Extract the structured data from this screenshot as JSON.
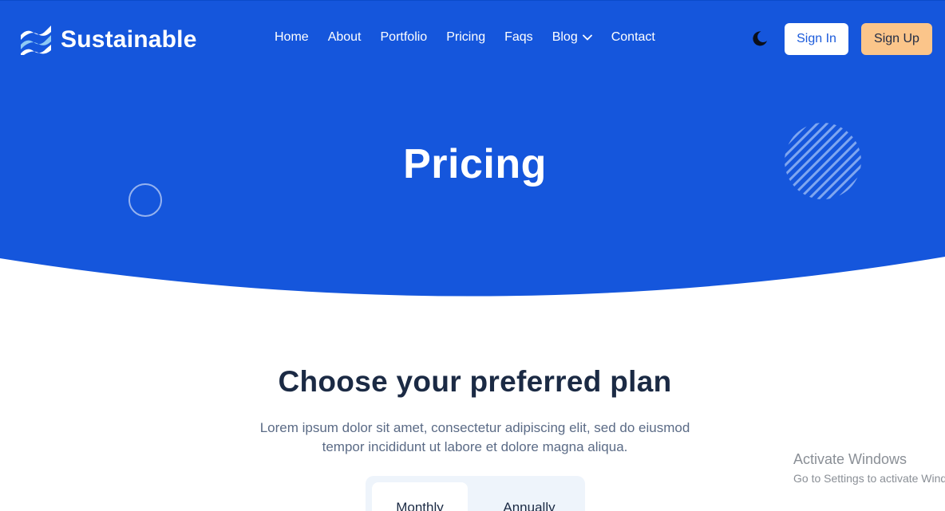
{
  "brand": {
    "name": "Sustainable",
    "primary_color": "#1556dc",
    "accent_color": "#fbc58a",
    "logo_icon": "stripes-logo-icon"
  },
  "nav": {
    "items": [
      {
        "label": "Home"
      },
      {
        "label": "About"
      },
      {
        "label": "Portfolio"
      },
      {
        "label": "Pricing"
      },
      {
        "label": "Faqs"
      },
      {
        "label": "Blog",
        "icon": "chevron-down-icon"
      },
      {
        "label": "Contact"
      }
    ],
    "theme_icon": "moon-icon",
    "signin_label": "Sign In",
    "signup_label": "Sign Up"
  },
  "hero": {
    "title": "Pricing"
  },
  "plans": {
    "title": "Choose your preferred plan",
    "description": "Lorem ipsum dolor sit amet, consectetur adipiscing elit, sed do eiusmod tempor incididunt ut labore et dolore magna aliqua.",
    "toggle": {
      "options": [
        "Monthly",
        "Annually"
      ],
      "selected": "Monthly"
    }
  },
  "watermark": {
    "title": "Activate Windows",
    "subtitle": "Go to Settings to activate Windows."
  }
}
